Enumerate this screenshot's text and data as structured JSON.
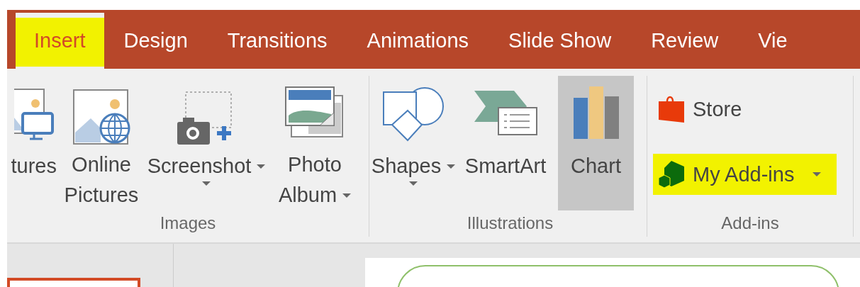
{
  "tabs": [
    {
      "label": "Insert",
      "selected": true,
      "highlighted": true
    },
    {
      "label": "Design",
      "selected": false,
      "highlighted": false
    },
    {
      "label": "Transitions",
      "selected": false,
      "highlighted": false
    },
    {
      "label": "Animations",
      "selected": false,
      "highlighted": false
    },
    {
      "label": "Slide Show",
      "selected": false,
      "highlighted": false
    },
    {
      "label": "Review",
      "selected": false,
      "highlighted": false
    },
    {
      "label": "Vie",
      "selected": false,
      "highlighted": false
    }
  ],
  "groups": [
    {
      "label": "Images",
      "buttons": [
        {
          "kind": "monitor-picture",
          "lines": [
            "tures"
          ],
          "dropdown": false,
          "pressed": false
        },
        {
          "kind": "online-pictures",
          "lines": [
            "Online",
            "Pictures"
          ],
          "dropdown": false,
          "pressed": false
        },
        {
          "kind": "screenshot",
          "lines": [
            "Screenshot"
          ],
          "dropdown": true,
          "pressed": false
        },
        {
          "kind": "photo-album",
          "lines": [
            "Photo",
            "Album"
          ],
          "dropdown": true,
          "pressed": false
        }
      ]
    },
    {
      "label": "Illustrations",
      "buttons": [
        {
          "kind": "shapes",
          "lines": [
            "Shapes"
          ],
          "dropdown": true,
          "pressed": false
        },
        {
          "kind": "smartart",
          "lines": [
            "SmartArt"
          ],
          "dropdown": false,
          "pressed": false
        },
        {
          "kind": "chart",
          "lines": [
            "Chart"
          ],
          "dropdown": false,
          "pressed": true
        }
      ]
    },
    {
      "label": "Add-ins",
      "small_buttons": [
        {
          "kind": "store",
          "label": "Store",
          "dropdown": false,
          "highlighted": false
        },
        {
          "kind": "addins",
          "label": "My Add-ins",
          "dropdown": true,
          "highlighted": true
        }
      ]
    }
  ]
}
